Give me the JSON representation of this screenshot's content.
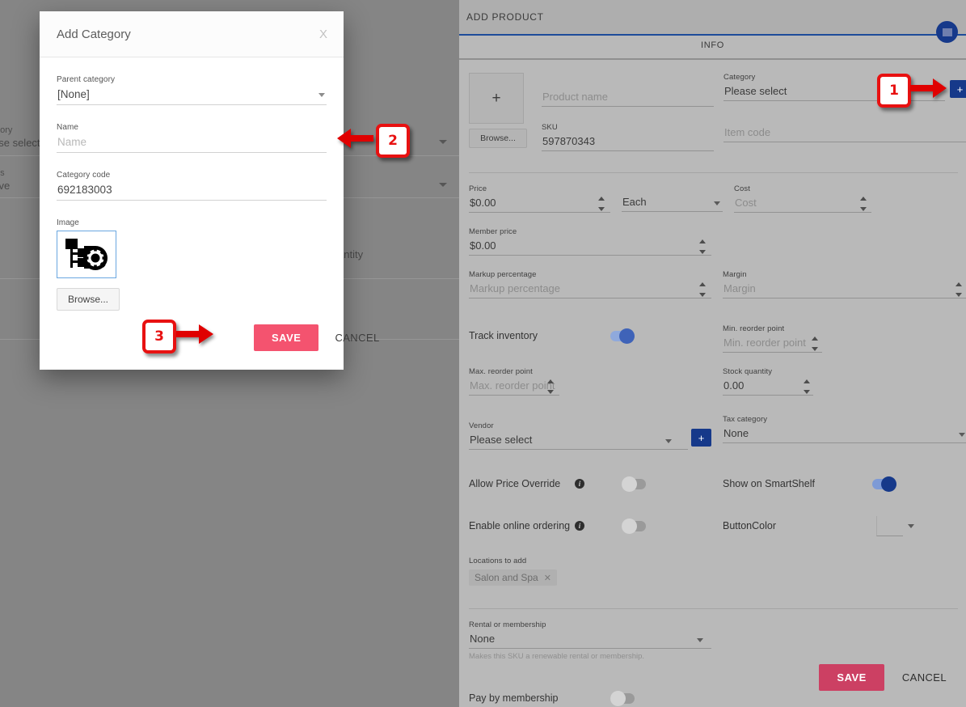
{
  "dialog": {
    "title": "Add Category",
    "close_label": "X",
    "parent_category": {
      "label": "Parent category",
      "value": "[None]"
    },
    "name": {
      "label": "Name",
      "value": "",
      "placeholder": "Name"
    },
    "category_code": {
      "label": "Category code",
      "value": "692183003"
    },
    "image": {
      "label": "Image",
      "icon": "broken-image-gear-icon",
      "browse_label": "Browse..."
    },
    "save_label": "SAVE",
    "cancel_label": "CANCEL"
  },
  "background_form": {
    "category": {
      "label": "gory",
      "value": "ase select"
    },
    "status": {
      "label": "us",
      "value": "tive"
    },
    "quantity": {
      "label": "antity"
    }
  },
  "panel": {
    "title": "ADD PRODUCT",
    "badge_icon": "window-square-icon",
    "tab_info": "INFO",
    "thumbnail": {
      "plus": "+",
      "browse_label": "Browse..."
    },
    "product_name": {
      "label": "",
      "value": "",
      "placeholder": "Product name"
    },
    "sku": {
      "label": "SKU",
      "value": "597870343"
    },
    "category": {
      "label": "Category",
      "value": "Please select",
      "add_label": "+"
    },
    "item_code": {
      "label": "",
      "value": "",
      "placeholder": "Item code"
    },
    "price": {
      "label": "Price",
      "value": "$0.00"
    },
    "unit": {
      "label": "",
      "value": "Each"
    },
    "cost": {
      "label": "Cost",
      "value": "",
      "placeholder": "Cost"
    },
    "member_price": {
      "label": "Member price",
      "value": "$0.00"
    },
    "markup_percentage": {
      "label": "Markup percentage",
      "value": "",
      "placeholder": "Markup percentage"
    },
    "margin": {
      "label": "Margin",
      "value": "",
      "placeholder": "Margin"
    },
    "track_inventory": {
      "label": "Track inventory",
      "state": "on"
    },
    "min_reorder_point": {
      "label": "Min. reorder point",
      "value": "",
      "placeholder": "Min. reorder point"
    },
    "max_reorder_point": {
      "label": "Max. reorder point",
      "value": "",
      "placeholder": "Max. reorder point"
    },
    "stock_quantity": {
      "label": "Stock quantity",
      "value": "0.00"
    },
    "vendor": {
      "label": "Vendor",
      "value": "Please select",
      "add_label": "+"
    },
    "tax_category": {
      "label": "Tax category",
      "value": "None"
    },
    "allow_price_override": {
      "label": "Allow Price Override",
      "state": "off"
    },
    "show_on_smartshelf": {
      "label": "Show on SmartShelf",
      "state": "on"
    },
    "enable_online_ordering": {
      "label": "Enable online ordering",
      "state": "off"
    },
    "button_color": {
      "label": "ButtonColor",
      "value": ""
    },
    "locations_to_add": {
      "label": "Locations to add",
      "chip": "Salon and Spa",
      "chip_remove": "✕"
    },
    "rental_or_membership": {
      "label": "Rental or membership",
      "value": "None",
      "helper": "Makes this SKU a renewable rental or membership."
    },
    "pay_by_membership": {
      "label": "Pay by membership",
      "state": "off"
    },
    "save_label": "SAVE",
    "cancel_label": "CANCEL"
  },
  "annotations": {
    "one": "1",
    "two": "2",
    "three": "3"
  },
  "colors": {
    "accent_blue": "#16398a",
    "save_pink": "#f4536f",
    "save_red": "#cc4063",
    "annotation_red": "#e81111",
    "toggle_on": "#16398a"
  }
}
